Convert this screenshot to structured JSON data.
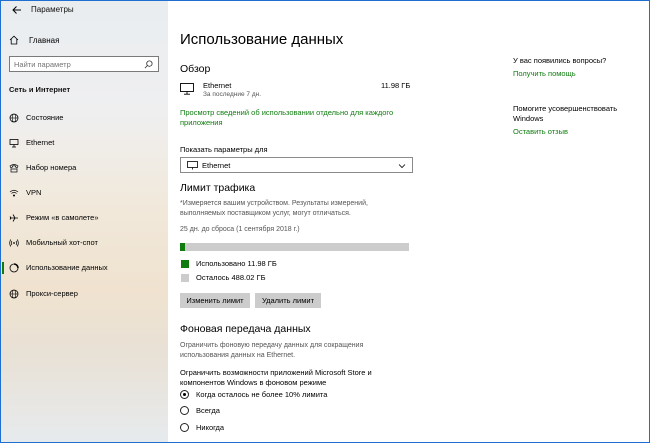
{
  "window": {
    "title": "Параметры"
  },
  "sidebar": {
    "home_label": "Главная",
    "search_placeholder": "Найти параметр",
    "section_label": "Сеть и Интернет",
    "items": [
      {
        "label": "Состояние",
        "icon": "globe-icon"
      },
      {
        "label": "Ethernet",
        "icon": "ethernet-icon"
      },
      {
        "label": "Набор номера",
        "icon": "dialup-icon"
      },
      {
        "label": "VPN",
        "icon": "vpn-icon"
      },
      {
        "label": "Режим «в самолете»",
        "icon": "airplane-icon"
      },
      {
        "label": "Мобильный хот-спот",
        "icon": "hotspot-icon"
      },
      {
        "label": "Использование данных",
        "icon": "data-usage-icon",
        "selected": true
      },
      {
        "label": "Прокси-сервер",
        "icon": "proxy-globe-icon"
      }
    ]
  },
  "main": {
    "title": "Использование данных",
    "overview": {
      "heading": "Обзор",
      "connection_name": "Ethernet",
      "period": "За последние 7 дн.",
      "usage_value": "11.98 ГБ",
      "link_line1": "Просмотр сведений об использовании отдельно для каждого",
      "link_line2": "приложения"
    },
    "show_settings_label": "Показать параметры для",
    "show_settings_value": "Ethernet",
    "limit": {
      "heading": "Лимит трафика",
      "note_line1": "*Измеряется вашим устройством. Результаты измерений,",
      "note_line2": "выполняемых поставщиком услуг, могут отличаться.",
      "reset_text": "25 дн. до сброса (1 сентября 2018 г.)",
      "used_fraction": 0.024,
      "used_label": "Использовано 11.98 ГБ",
      "remaining_label": "Осталось 488.02 ГБ",
      "change_button": "Изменить лимит",
      "delete_button": "Удалить лимит"
    },
    "background": {
      "heading": "Фоновая передача данных",
      "desc_line1": "Ограничить фоновую передачу данных для сокращения",
      "desc_line2": "использования данных на Ethernet.",
      "restrict_line1": "Ограничить возможности приложений Microsoft Store и",
      "restrict_line2": "компонентов Windows в фоновом режиме",
      "options": [
        {
          "label": "Когда осталось не более 10% лимита",
          "checked": true
        },
        {
          "label": "Всегда",
          "checked": false
        },
        {
          "label": "Никогда",
          "checked": false
        }
      ]
    }
  },
  "aside": {
    "question": "У вас появились вопросы?",
    "help_link": "Получить помощь",
    "improve_line1": "Помогите усовершенствовать",
    "improve_line2": "Windows",
    "feedback_link": "Оставить отзыв"
  },
  "colors": {
    "accent": "#107c10",
    "used_swatch": "#107c10",
    "remaining_swatch": "#cccccc"
  }
}
